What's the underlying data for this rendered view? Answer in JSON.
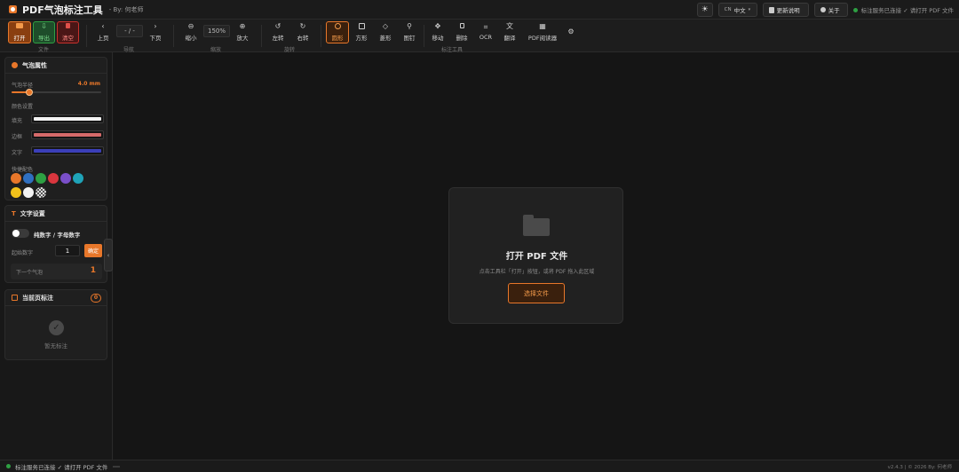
{
  "app": {
    "title": "PDF气泡标注工具",
    "by": "- By: 何老师"
  },
  "titlebar": {
    "lang_flag": "CN",
    "lang_label": "中文",
    "update_label": "更新说明",
    "about_label": "关于",
    "status_text": "标注服务已连接 ✓ 请打开 PDF 文件"
  },
  "toolbar": {
    "file": {
      "open": "打开",
      "export": "导出",
      "clear": "清空",
      "group": "文件"
    },
    "nav": {
      "prev": "上页",
      "page": "- / -",
      "next": "下页",
      "group": "导航"
    },
    "zoom": {
      "out": "缩小",
      "value": "150%",
      "in": "放大",
      "group": "缩放"
    },
    "rotate": {
      "left": "左转",
      "right": "右转",
      "group": "旋转"
    },
    "tools": {
      "circle": "圆形",
      "square": "方形",
      "diamond": "菱形",
      "pin": "图钉",
      "move": "移动",
      "delete": "删除",
      "ocr": "OCR",
      "translate": "翻译",
      "reader": "PDF阅读器",
      "group": "标注工具"
    }
  },
  "sidebar": {
    "bubble": {
      "title": "气泡属性",
      "radius_label": "气泡半径",
      "radius_value": "4.0 mm",
      "radius_level": 0.2,
      "color_section": "颜色设置",
      "fill_label": "填充",
      "border_label": "边框",
      "text_label": "文字",
      "fill_color": "#f2f2f2",
      "border_color": "#d66a6a",
      "text_color": "#3b3fb8",
      "quick_label": "快捷配色",
      "swatches": [
        "#e8772a",
        "#2f6fc0",
        "#2ea043",
        "#d9363e",
        "#7a4fc9",
        "#1fa3b8",
        "#f2c21b",
        "#f2f2f2",
        "checker"
      ]
    },
    "text": {
      "title": "文字设置",
      "toggle_label": "纯数字 / 字母数字",
      "start_label": "起始数字",
      "start_value": "1",
      "confirm": "确定",
      "next_label": "下一个气泡",
      "next_value": "1"
    },
    "current": {
      "title": "当前页标注",
      "count": "0",
      "empty": "暂无标注"
    }
  },
  "drop": {
    "title": "打开 PDF 文件",
    "hint": "点击工具栏「打开」按钮，或将 PDF 拖入此区域",
    "button": "选择文件"
  },
  "statusbar": {
    "text": "标注服务已连接 ✓ 请打开 PDF 文件",
    "version": "v2.4.3 | © 2026 By: 何老师"
  },
  "colors": {
    "accent": "#e8772a",
    "success": "#2ea043",
    "danger": "#c9302c"
  }
}
